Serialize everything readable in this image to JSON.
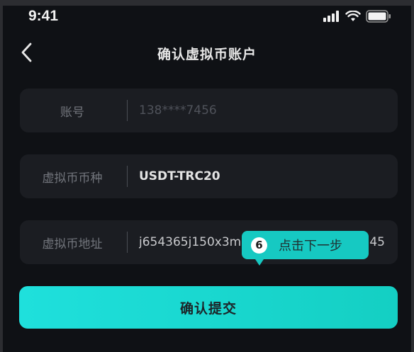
{
  "status_bar": {
    "time": "9:41",
    "icons": [
      "signal-icon",
      "wifi-icon",
      "battery-icon"
    ]
  },
  "nav": {
    "back_icon": "chevron-left-icon",
    "title": "确认虚拟币账户"
  },
  "fields": [
    {
      "label": "账号",
      "value": "138****7456"
    },
    {
      "label": "虚拟币币种",
      "value": "USDT-TRC20"
    },
    {
      "label": "虚拟币地址",
      "value": "j654365j150x3m",
      "value_tail": "45"
    }
  ],
  "tooltip": {
    "step": "6",
    "text": "点击下一步"
  },
  "submit": {
    "label": "确认提交"
  },
  "colors": {
    "background": "#0f1115",
    "field_bg": "#1b1d22",
    "accent": "#16c9c2"
  }
}
